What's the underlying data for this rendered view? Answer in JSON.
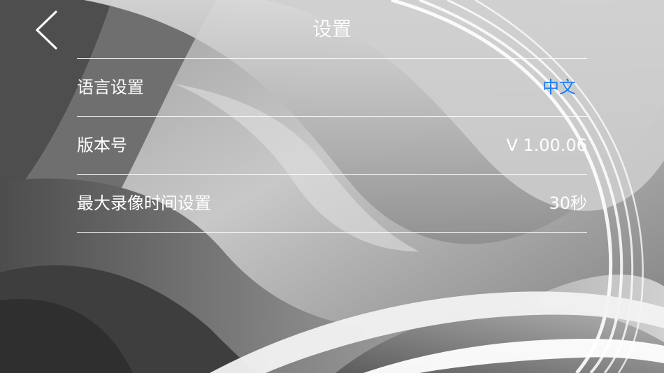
{
  "header": {
    "title": "设置",
    "back_icon": "chevron-left-icon"
  },
  "settings": {
    "items": [
      {
        "label": "语言设置",
        "value": "中文"
      },
      {
        "label": "版本号",
        "value": "V 1.00.06"
      },
      {
        "label": "最大录像时间设置",
        "value": "30秒"
      }
    ]
  },
  "colors": {
    "accent": "#1e7ef0",
    "text": "#ffffff",
    "divider": "#ffffff"
  }
}
